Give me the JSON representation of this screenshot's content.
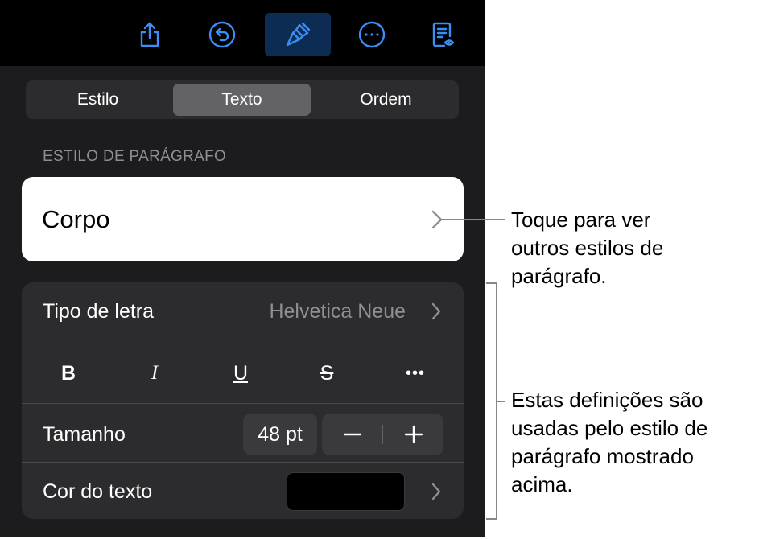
{
  "toolbar": {
    "buttons": [
      {
        "icon": "share-icon"
      },
      {
        "icon": "undo-icon"
      },
      {
        "icon": "format-brush-icon",
        "active": true
      },
      {
        "icon": "more-icon"
      },
      {
        "icon": "reading-view-icon"
      }
    ],
    "accent": "#3a8ef6"
  },
  "tabs": [
    {
      "label": "Estilo",
      "active": false
    },
    {
      "label": "Texto",
      "active": true
    },
    {
      "label": "Ordem",
      "active": false
    }
  ],
  "paragraph_style": {
    "header": "ESTILO DE PARÁGRAFO",
    "current": "Corpo"
  },
  "font": {
    "label": "Tipo de letra",
    "value": "Helvetica Neue"
  },
  "format_buttons": [
    {
      "label": "B"
    },
    {
      "label": "I"
    },
    {
      "label": "U"
    },
    {
      "label": "S"
    },
    {
      "label": "•••"
    }
  ],
  "size": {
    "label": "Tamanho",
    "value": "48 pt",
    "minus": "−",
    "plus": "+"
  },
  "text_color": {
    "label": "Cor do texto",
    "color": "#000000"
  },
  "callouts": {
    "style_callout": [
      "Toque para ver",
      "outros estilos de",
      "parágrafo."
    ],
    "settings_callout": [
      "Estas definições são",
      "usadas pelo estilo de",
      "parágrafo mostrado",
      "acima."
    ]
  }
}
